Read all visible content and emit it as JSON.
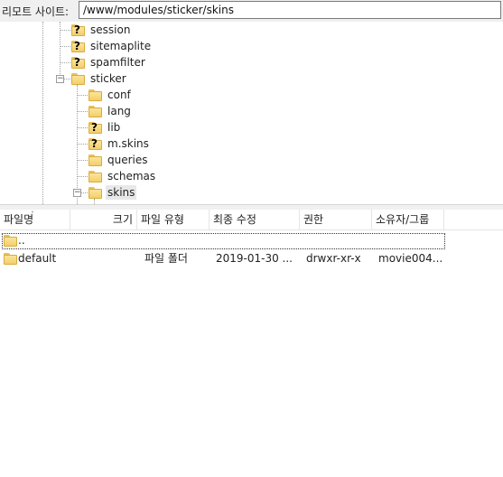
{
  "remote_site": {
    "label": "리모트 사이트:",
    "path": "/www/modules/sticker/skins"
  },
  "tree": {
    "nodes": [
      {
        "label": "session",
        "icon": "unknown-folder-icon"
      },
      {
        "label": "sitemaplite",
        "icon": "unknown-folder-icon"
      },
      {
        "label": "spamfilter",
        "icon": "unknown-folder-icon"
      },
      {
        "label": "sticker",
        "icon": "folder-icon",
        "expander": "−"
      },
      {
        "label": "conf",
        "icon": "folder-icon"
      },
      {
        "label": "lang",
        "icon": "folder-icon"
      },
      {
        "label": "lib",
        "icon": "unknown-folder-icon"
      },
      {
        "label": "m.skins",
        "icon": "unknown-folder-icon"
      },
      {
        "label": "queries",
        "icon": "folder-icon"
      },
      {
        "label": "schemas",
        "icon": "folder-icon"
      },
      {
        "label": "skins",
        "icon": "folder-icon",
        "expander": "−",
        "selected": true
      }
    ],
    "unknown_glyph": "?"
  },
  "list": {
    "columns": {
      "name": "파일명",
      "size": "크기",
      "type": "파일 유형",
      "modified": "최종 수정",
      "perms": "권한",
      "owner": "소유자/그룹"
    },
    "sort_indicator": "˅",
    "rows": [
      {
        "name": "..",
        "size": "",
        "type": "",
        "modified": "",
        "perms": "",
        "owner": ""
      },
      {
        "name": "default",
        "size": "",
        "type": "파일 폴더",
        "modified": "2019-01-30 ...",
        "perms": "drwxr-xr-x",
        "owner": "movie004..."
      }
    ]
  },
  "colors": {
    "folder": "#f3cf6a",
    "selected": "#e8e8e8",
    "chrome": "#f0f0f0"
  }
}
